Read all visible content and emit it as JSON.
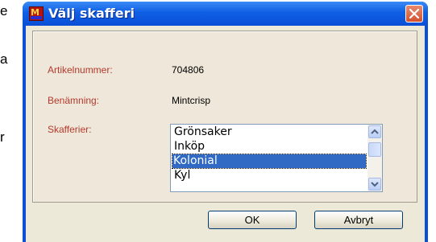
{
  "background": {
    "text_1": "e",
    "text_2": "a",
    "text_3": "r"
  },
  "dialog": {
    "title": "Välj skafferi",
    "fields": {
      "article_number_label": "Artikelnummer:",
      "article_number_value": "704806",
      "name_label": "Benämning:",
      "name_value": "Mintcrisp",
      "pantries_label": "Skafferier:"
    },
    "pantry_list": {
      "items": [
        "Grönsaker",
        "Inköp",
        "Kolonial",
        "Kyl"
      ],
      "selected": "Kolonial"
    },
    "buttons": {
      "ok": "OK",
      "cancel": "Avbryt"
    }
  },
  "colors": {
    "title_bar": "#0a4fd6",
    "selection": "#316ac5",
    "label": "#b43a2c"
  }
}
